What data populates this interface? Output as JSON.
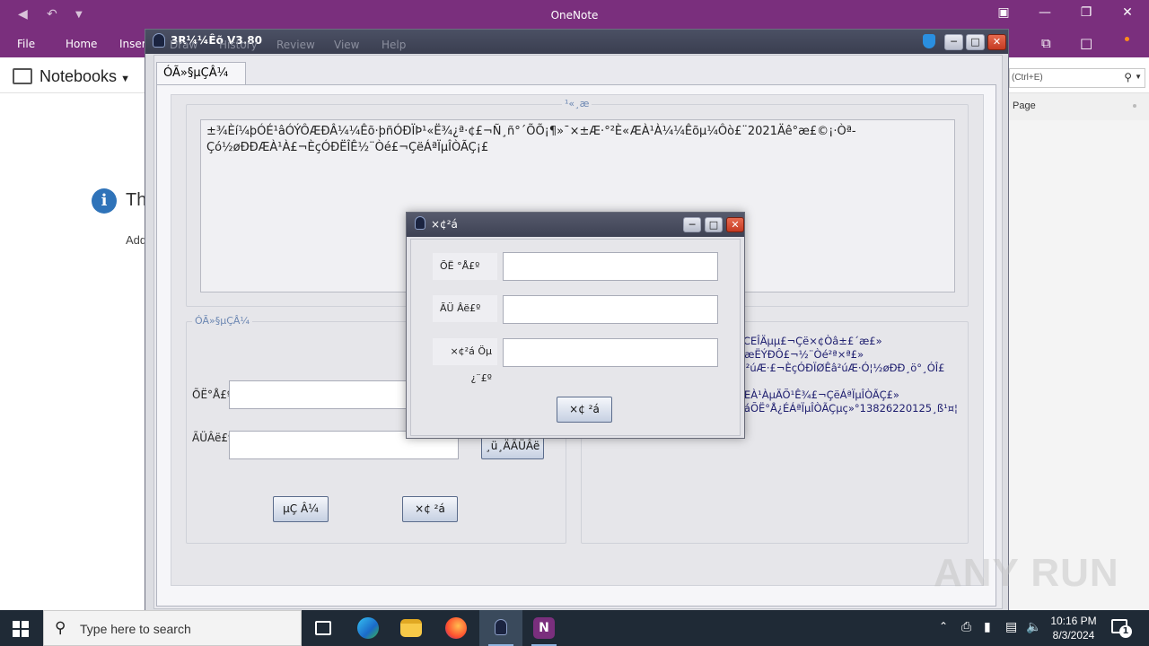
{
  "onenote": {
    "title": "OneNote",
    "tabs": [
      "File",
      "Home",
      "Insert",
      "Draw",
      "History",
      "Review",
      "View",
      "Help"
    ],
    "notebooks_label": "Notebooks",
    "search_placeholder": "(Ctrl+E)",
    "pages_label": "Page",
    "info_heading": "Th",
    "info_sub": "Add"
  },
  "app": {
    "title": "3R¼¼Êõ V3.80",
    "tab_label": "ÓÃ»§µÇÂ¼",
    "notice_legend": "¹«¸æ",
    "notice_text": "±¾Èí¼þÓÉ¹âÓÝÔÆÐÂ¼¼Êõ·þñÓÐÏÞ¹«Ë¾¿ª·¢£¬Ñ¸ñ°´ÕÕ¡¶»¯×±Æ·°²È«ÆÀ¹À¼¼Êõµ¼Ôò£¨2021Äê°æ£©¡·Òª­Çó½øÐÐÆÀ¹À£¬ÈçÓÐËÎÊ½¨Òé£¬ÇëÁªÏµÎÒÃÇ¡£",
    "login_legend": "ÓÃ»§µÇÂ¼",
    "username_label": "ÕË°Å£º",
    "password_label": "ÃÜÂë£º",
    "forgot_button": "¸ü¸ÄÃÜÂë",
    "login_button": "µÇ Â¼",
    "register_button": "×¢ ²á",
    "info_lines": [
      "FICEÎÄµµ£¬Çë×¢Òâ±£´æ£»",
      "¾æËÝÐÔ£¬½¨Òé²ª×ª£»",
      "£ª²úÆ·£¬ÈçÓÐÏØÊâ²úÆ·Ó¦½øÐÐ¸ö°¸ÓÎ£",
      "",
      "ÝÆÀ¹ÀµÄÕ¹Ê¾£¬ÇëÁªÏµÎÒÃÇ£»",
      "ç²áÕË°Å¿ÉÁªÏµÎÒÃÇµç»°13826220125¸ß¹¤¦"
    ]
  },
  "dialog": {
    "title": "×¢²á",
    "username_label": "ÕË    °Å£º",
    "password_label": "ÃÜ    Âë£º",
    "code_label": "×¢²á Öµ ¿¨£º",
    "submit_button": "×¢ ²á"
  },
  "taskbar": {
    "search_placeholder": "Type here to search",
    "time": "10:16 PM",
    "date": "8/3/2024",
    "notification_count": "1"
  },
  "watermark": "ANY RUN"
}
